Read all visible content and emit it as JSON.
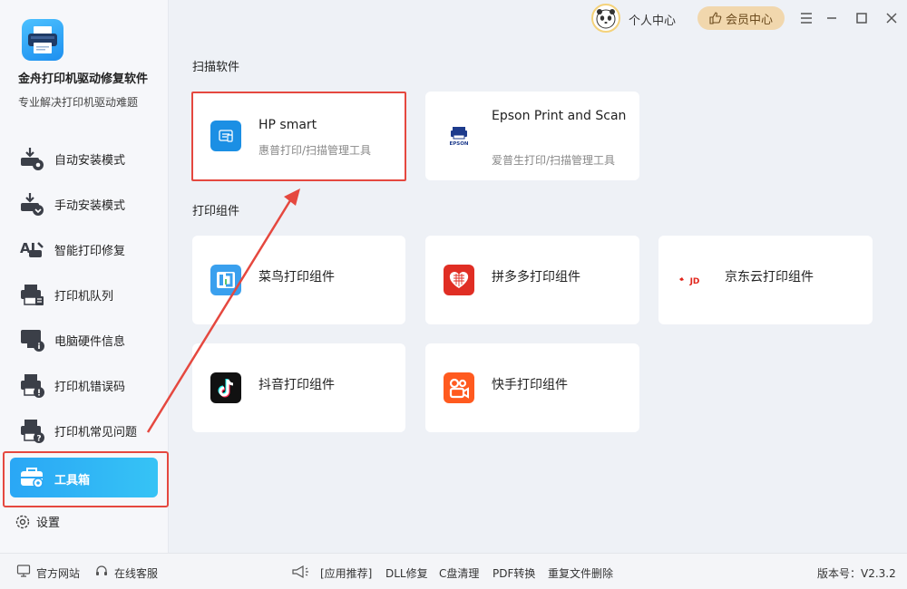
{
  "app": {
    "title": "金舟打印机驱动修复软件",
    "subtitle": "专业解决打印机驱动难题"
  },
  "sidebar": {
    "items": [
      {
        "label": "自动安装模式",
        "icon": "auto-install-icon"
      },
      {
        "label": "手动安装模式",
        "icon": "manual-install-icon"
      },
      {
        "label": "智能打印修复",
        "icon": "ai-repair-icon"
      },
      {
        "label": "打印机队列",
        "icon": "printer-queue-icon"
      },
      {
        "label": "电脑硬件信息",
        "icon": "hardware-info-icon"
      },
      {
        "label": "打印机错误码",
        "icon": "error-code-icon"
      },
      {
        "label": "打印机常见问题",
        "icon": "faq-icon"
      },
      {
        "label": "工具箱",
        "icon": "toolbox-icon",
        "active": true
      }
    ],
    "settings_label": "设置"
  },
  "topbar": {
    "personal_label": "个人中心",
    "vip_label": "会员中心"
  },
  "main": {
    "scan_section": "扫描软件",
    "print_section": "打印组件",
    "scan_cards": [
      {
        "name": "HP smart",
        "desc": "惠普打印/扫描管理工具"
      },
      {
        "name": "Epson Print and Scan",
        "desc": "爱普生打印/扫描管理工具"
      }
    ],
    "print_cards": [
      {
        "name": "菜鸟打印组件"
      },
      {
        "name": "拼多多打印组件"
      },
      {
        "name": "京东云打印组件"
      },
      {
        "name": "抖音打印组件"
      },
      {
        "name": "快手打印组件"
      }
    ]
  },
  "footer": {
    "official_site": "官方网站",
    "online_service": "在线客服",
    "recommend": "[应用推荐]",
    "links": [
      "DLL修复",
      "C盘清理",
      "PDF转换",
      "重复文件删除"
    ],
    "version": "版本号：V2.3.2"
  },
  "colors": {
    "accent": "#2aa7f5",
    "highlight": "#e5483f",
    "vip_bg": "#f1d7ad"
  }
}
